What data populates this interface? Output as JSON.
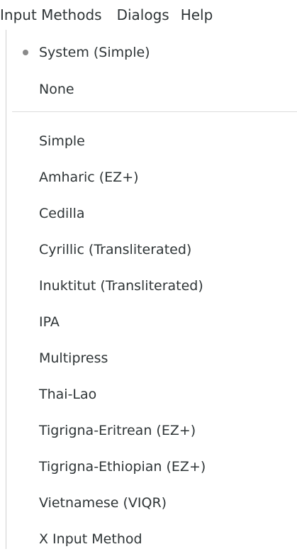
{
  "menubar": {
    "items": [
      {
        "label": "Input Methods"
      },
      {
        "label": "Dialogs"
      },
      {
        "label": "Help"
      }
    ]
  },
  "menu": {
    "radio_items": [
      {
        "label": "System (Simple)",
        "checked": true
      },
      {
        "label": "None",
        "checked": false
      }
    ],
    "methods": [
      {
        "label": "Simple"
      },
      {
        "label": "Amharic (EZ+)"
      },
      {
        "label": "Cedilla"
      },
      {
        "label": "Cyrillic (Transliterated)"
      },
      {
        "label": "Inuktitut (Transliterated)"
      },
      {
        "label": "IPA"
      },
      {
        "label": "Multipress"
      },
      {
        "label": "Thai-Lao"
      },
      {
        "label": "Tigrigna-Eritrean (EZ+)"
      },
      {
        "label": "Tigrigna-Ethiopian (EZ+)"
      },
      {
        "label": "Vietnamese (VIQR)"
      },
      {
        "label": "X Input Method"
      }
    ]
  }
}
